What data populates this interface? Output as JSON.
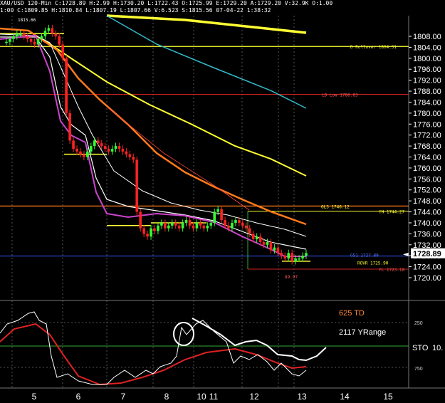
{
  "header": {
    "line1": "XAU/USD 120-Min C:1728.89 H:2.99 H:1730.20 L:1722.43 O:1725.99 E:1729.20 A:1729.20 V:32.9K O:1.00",
    "line2": "1:00 C:1809.85 H:1810.84 L:1807.19 L:1807.66 V:6.523 S:1815.56 07-04-22 1:38:32"
  },
  "price_axis": {
    "labels": [
      "1808.00",
      "1804.00",
      "1800.00",
      "1796.00",
      "1792.00",
      "1788.00",
      "1784.00",
      "1780.00",
      "1776.00",
      "1772.00",
      "1768.00",
      "1764.00",
      "1760.00",
      "1756.00",
      "1752.00",
      "1748.00",
      "1744.00",
      "1740.00",
      "1736.00",
      "1732.00",
      "1728.00",
      "1724.00",
      "1720.00"
    ],
    "current_price": "1728.89"
  },
  "day_axis": {
    "labels": [
      "5",
      "6",
      "7",
      "8",
      "10",
      "11",
      "12",
      "13",
      "14",
      "15"
    ]
  },
  "annotations": {
    "rollover": "D Rollover 1804.31",
    "ld_low": "LD Low 1786.83",
    "gl3": "GL3 1746.12",
    "yh": "YH 1744.27",
    "gs1": "GS1 1727.89",
    "rovr": "ROVR 1725.90",
    "yl": "YL 1723.10",
    "hi_label": "1815.66",
    "small_label": "89.97"
  },
  "indicator": {
    "label_td": "625 TD",
    "label_range": "2117 YRange",
    "label_sto": "STO",
    "label_sto_val": "10.",
    "level_high": "250",
    "level_low": "750"
  },
  "colors": {
    "background": "#000000",
    "grid": "#3a3a3a",
    "yellow": "#ffff33",
    "cyan": "#33bbcc",
    "orange": "#ff7a1a",
    "white": "#ffffff",
    "magenta": "#cc44cc",
    "red_level": "#cc2222",
    "up_candle": "#33ff33",
    "down_candle": "#ff2222",
    "stoch_red": "#dd2222",
    "orange_text": "#ff8833"
  },
  "chart_data": {
    "type": "candlestick",
    "symbol": "XAU/USD",
    "timeframe": "120-Min",
    "ylim": [
      1716,
      1812
    ],
    "day_labels": [
      "5",
      "6",
      "7",
      "8",
      "10",
      "11",
      "12",
      "13",
      "14",
      "15"
    ],
    "levels": [
      {
        "name": "D Rollover",
        "value": 1804.31
      },
      {
        "name": "LD Low",
        "value": 1786.83
      },
      {
        "name": "GL3",
        "value": 1746.12
      },
      {
        "name": "YH",
        "value": 1744.27
      },
      {
        "name": "GS1",
        "value": 1727.89
      },
      {
        "name": "ROVR",
        "value": 1725.9
      },
      {
        "name": "YL",
        "value": 1723.1
      }
    ],
    "last_price": 1728.89,
    "close_series": [
      1806,
      1806,
      1807,
      1808,
      1809,
      1809,
      1808,
      1807,
      1806,
      1805,
      1807,
      1808,
      1810,
      1811,
      1809,
      1808,
      1805,
      1800,
      1780,
      1770,
      1767,
      1766,
      1765,
      1764,
      1766,
      1768,
      1770,
      1769,
      1768,
      1767,
      1766,
      1767,
      1768,
      1767,
      1766,
      1765,
      1764,
      1763,
      1744,
      1738,
      1736,
      1735,
      1738,
      1737,
      1739,
      1740,
      1738,
      1739,
      1740,
      1739,
      1738,
      1740,
      1741,
      1739,
      1738,
      1740,
      1739,
      1738,
      1739,
      1740,
      1744,
      1745,
      1741,
      1739,
      1738,
      1740,
      1741,
      1740,
      1739,
      1738,
      1736,
      1734,
      1735,
      1733,
      1732,
      1733,
      1730,
      1731,
      1729,
      1728,
      1727,
      1729,
      1726,
      1727,
      1727,
      1728,
      1729
    ]
  }
}
